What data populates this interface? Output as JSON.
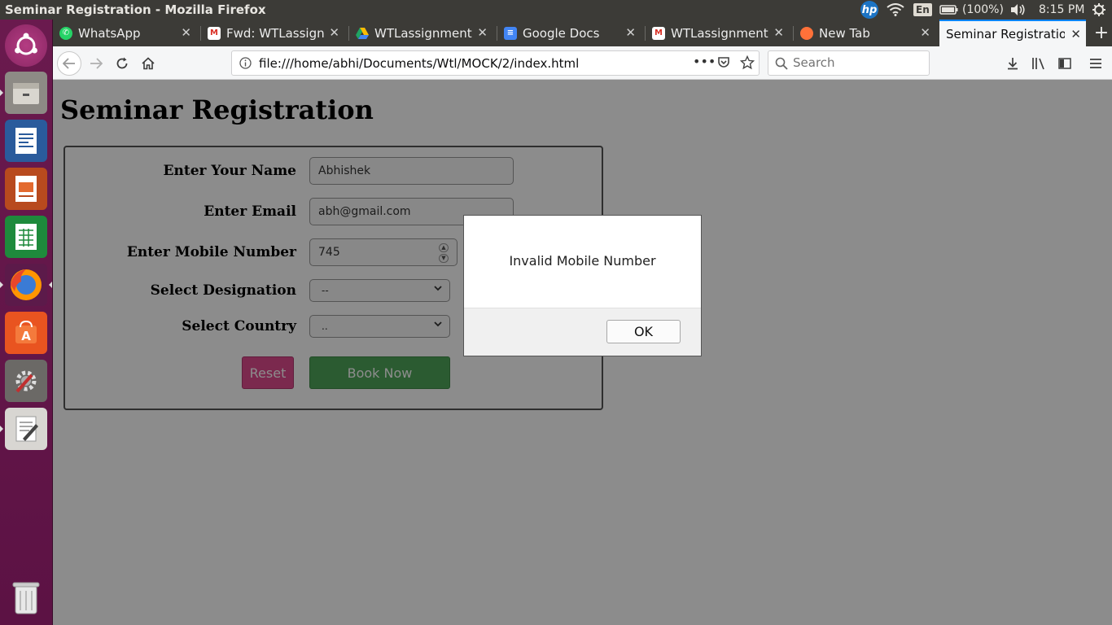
{
  "system": {
    "window_title": "Seminar Registration - Mozilla Firefox",
    "keyboard_layout": "En",
    "battery": "(100%)",
    "clock": "8:15 PM"
  },
  "launcher": {
    "items": [
      "ubuntu-dash",
      "files",
      "libreoffice-writer",
      "libreoffice-impress",
      "libreoffice-calc",
      "firefox",
      "ubuntu-software",
      "system-settings",
      "text-editor",
      "trash"
    ]
  },
  "tabs": [
    {
      "label": "WhatsApp",
      "icon": "whatsapp-icon",
      "color": "#25d366"
    },
    {
      "label": "Fwd: WTLassignm",
      "icon": "gmail-icon",
      "color": "#d93025"
    },
    {
      "label": "WTLassignments",
      "icon": "google-drive-icon",
      "color": "#1fa463"
    },
    {
      "label": "Google Docs",
      "icon": "google-docs-icon",
      "color": "#4285f4"
    },
    {
      "label": "WTLassignments",
      "icon": "gmail-icon",
      "color": "#d93025"
    },
    {
      "label": "New Tab",
      "icon": "firefox-icon",
      "color": "#ff7139"
    },
    {
      "label": "Seminar Registration",
      "icon": "",
      "color": ""
    }
  ],
  "nav": {
    "url": "file:///home/abhi/Documents/Wtl/MOCK/2/index.html",
    "search_placeholder": "Search"
  },
  "page": {
    "title": "Seminar Registration",
    "form": {
      "name_label": "Enter Your Name",
      "name_value": "Abhishek",
      "email_label": "Enter Email",
      "email_value": "abh@gmail.com",
      "mobile_label": "Enter Mobile Number",
      "mobile_value": "745",
      "designation_label": "Select Designation",
      "designation_value": "--",
      "country_label": "Select Country",
      "country_value": "..",
      "reset_label": "Reset",
      "book_label": "Book Now"
    }
  },
  "alert": {
    "message": "Invalid Mobile Number",
    "ok_label": "OK"
  },
  "colors": {
    "accent_tab": "#0a84ff",
    "reset_button": "#e14b8f",
    "book_button": "#4fa75a",
    "launcher_bg": "#6a1a4e"
  }
}
